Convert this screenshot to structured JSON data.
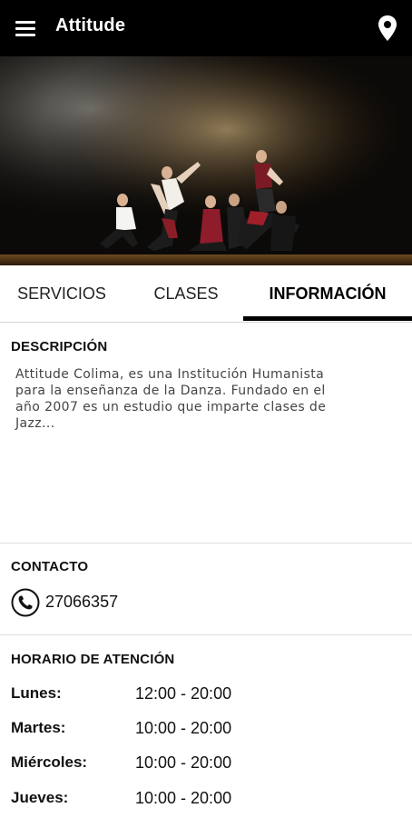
{
  "app_bar": {
    "title": "Attitude",
    "menu_icon": "hamburger-menu-icon",
    "location_icon": "map-pin-icon"
  },
  "hero": {
    "image": "dance-group-on-stage-photo"
  },
  "tabs": [
    {
      "label": "SERVICIOS",
      "active": false
    },
    {
      "label": "CLASES",
      "active": false
    },
    {
      "label": "INFORMACIÓN",
      "active": true
    }
  ],
  "description": {
    "title": "DESCRIPCIÓN",
    "lines": [
      "Attitude Colima, es una Institución Humanista",
      "para la enseñanza de la Danza. Fundado en el",
      "año 2007 es un estudio que imparte clases de",
      "Jazz..."
    ]
  },
  "contact": {
    "title": "CONTACTO",
    "phone_icon": "phone-icon",
    "phone": "27066357"
  },
  "schedule": {
    "title": "HORARIO DE ATENCIÓN",
    "rows": [
      {
        "day": "Lunes:",
        "hours": "12:00 - 20:00"
      },
      {
        "day": "Martes:",
        "hours": "10:00 - 20:00"
      },
      {
        "day": "Miércoles:",
        "hours": "10:00 - 20:00"
      },
      {
        "day": "Jueves:",
        "hours": "10:00 - 20:00"
      }
    ]
  },
  "colors": {
    "app_bar": "#000000",
    "tab_indicator": "#000000",
    "text": "#111111",
    "description_text": "#444444"
  }
}
